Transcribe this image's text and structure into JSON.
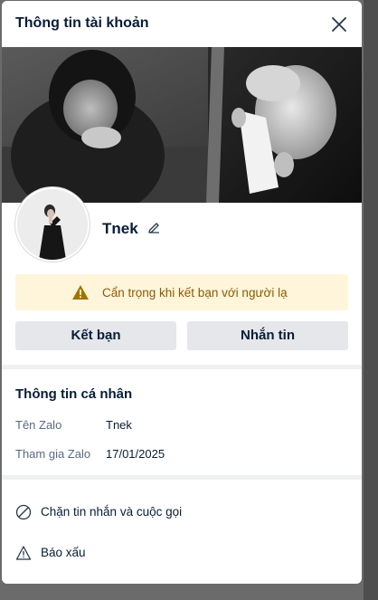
{
  "modal": {
    "title": "Thông tin tài khoản",
    "close_icon": "close-icon"
  },
  "profile": {
    "name": "Tnek",
    "edit_icon": "pencil-icon"
  },
  "warning": {
    "icon": "warning-triangle-icon",
    "text": "Cẩn trọng khi kết bạn với người lạ",
    "color": "#fff5db"
  },
  "actions": {
    "add_friend": "Kết bạn",
    "message": "Nhắn tin"
  },
  "personal_info": {
    "title": "Thông tin cá nhân",
    "rows": [
      {
        "label": "Tên Zalo",
        "value": "Tnek"
      },
      {
        "label": "Tham gia Zalo",
        "value": "17/01/2025"
      }
    ]
  },
  "options": [
    {
      "icon": "block-icon",
      "label": "Chặn tin nhắn và cuộc gọi"
    },
    {
      "icon": "report-warning-icon",
      "label": "Báo xấu"
    }
  ]
}
